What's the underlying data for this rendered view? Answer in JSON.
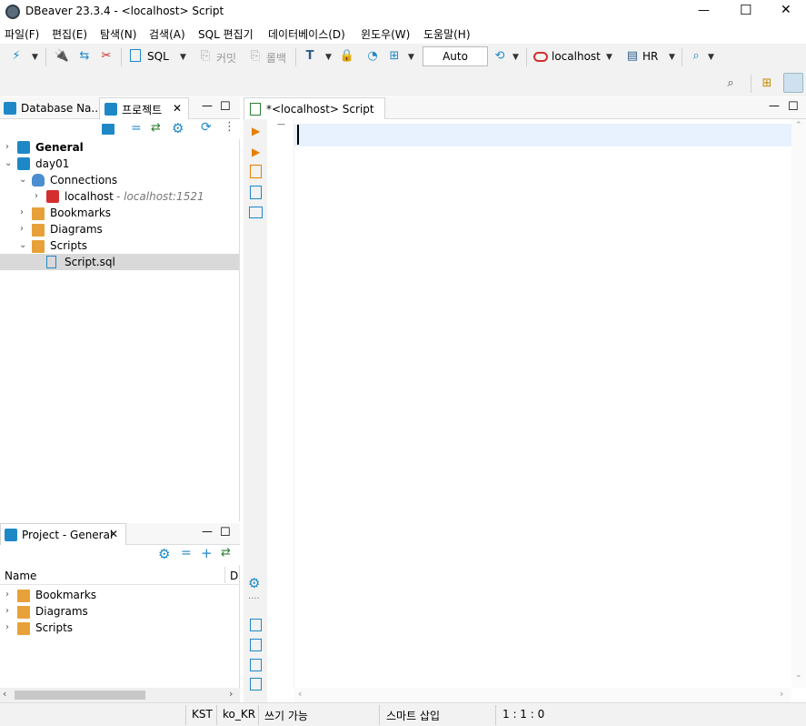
{
  "window": {
    "title": "DBeaver 23.3.4 - <localhost> Script",
    "minimize": "—",
    "maximize": "☐",
    "close": "✕"
  },
  "menu": [
    "파일(F)",
    "편집(E)",
    "탐색(N)",
    "검색(A)",
    "SQL 편집기",
    "데이터베이스(D)",
    "윈도우(W)",
    "도움말(H)"
  ],
  "toolbar": {
    "sql_label": "SQL",
    "commit_label": "커밋",
    "rollback_label": "롤백",
    "auto_label": "Auto",
    "connection_label": "localhost",
    "schema_label": "HR"
  },
  "left_panel": {
    "tab1": "Database Na...",
    "tab2": "프로젝트",
    "tree": {
      "general": "General",
      "day01": "day01",
      "connections": "Connections",
      "localhost": "localhost",
      "localhost_host": "- localhost:1521",
      "bookmarks": "Bookmarks",
      "diagrams": "Diagrams",
      "scripts": "Scripts",
      "script_sql": "Script.sql"
    }
  },
  "bottom_panel": {
    "tab": "Project - General",
    "col_name": "Name",
    "col_d": "D",
    "items": [
      "Bookmarks",
      "Diagrams",
      "Scripts"
    ]
  },
  "editor": {
    "tab_label": "*<localhost> Script"
  },
  "status": {
    "tz": "KST",
    "locale": "ko_KR",
    "mode": "쓰기 가능",
    "insert": "스마트 삽입",
    "position": "1 : 1 : 0"
  },
  "colors": {
    "accent_blue": "#1e88c7",
    "oracle_red": "#d32f2f",
    "folder_orange": "#e8a13a",
    "selection": "#d9d9d9",
    "current_line": "#e8f2fe"
  }
}
